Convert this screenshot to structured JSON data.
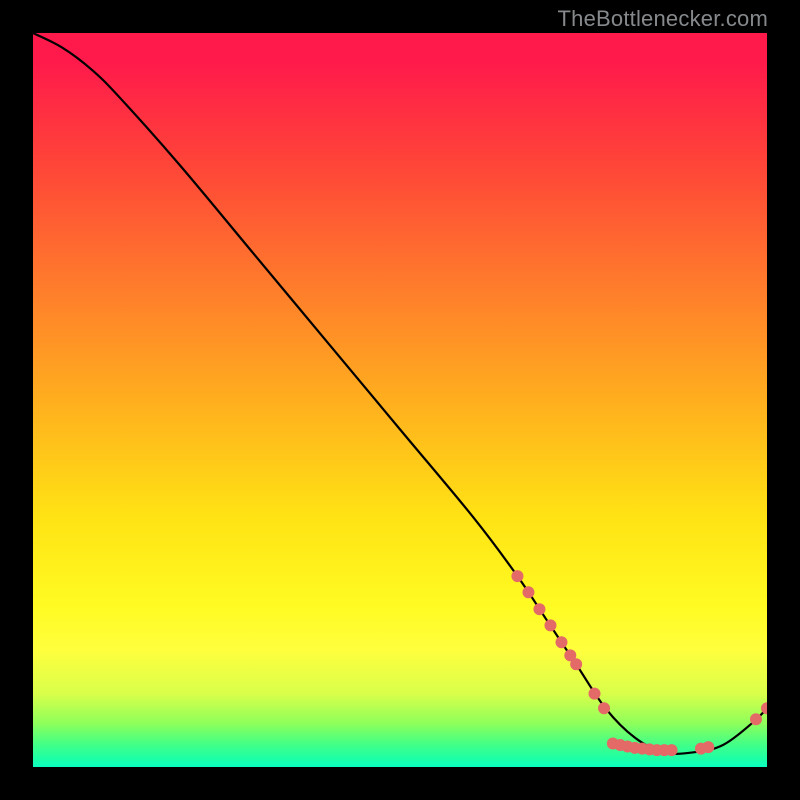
{
  "attribution": "TheBottlenecker.com",
  "chart_data": {
    "type": "line",
    "title": "",
    "xlabel": "",
    "ylabel": "",
    "xlim": [
      0,
      100
    ],
    "ylim": [
      0,
      100
    ],
    "series": [
      {
        "name": "curve",
        "x": [
          0,
          4,
          8,
          12,
          20,
          30,
          40,
          50,
          60,
          66,
          70,
          74,
          78,
          82,
          86,
          90,
          94,
          98,
          100
        ],
        "y": [
          100,
          98,
          95,
          91,
          82,
          70,
          58,
          46,
          34,
          26,
          20,
          14,
          8,
          4,
          2,
          2,
          3,
          6,
          8
        ]
      }
    ],
    "markers": [
      {
        "x": 66.0,
        "y": 26.0
      },
      {
        "x": 67.5,
        "y": 23.8
      },
      {
        "x": 69.0,
        "y": 21.5
      },
      {
        "x": 70.5,
        "y": 19.3
      },
      {
        "x": 72.0,
        "y": 17.0
      },
      {
        "x": 73.2,
        "y": 15.2
      },
      {
        "x": 74.0,
        "y": 14.0
      },
      {
        "x": 76.5,
        "y": 10.0
      },
      {
        "x": 77.8,
        "y": 8.0
      },
      {
        "x": 79.0,
        "y": 3.2
      },
      {
        "x": 80.0,
        "y": 3.0
      },
      {
        "x": 81.0,
        "y": 2.8
      },
      {
        "x": 82.0,
        "y": 2.6
      },
      {
        "x": 83.0,
        "y": 2.5
      },
      {
        "x": 84.0,
        "y": 2.4
      },
      {
        "x": 85.0,
        "y": 2.3
      },
      {
        "x": 86.0,
        "y": 2.3
      },
      {
        "x": 87.0,
        "y": 2.3
      },
      {
        "x": 91.0,
        "y": 2.5
      },
      {
        "x": 92.0,
        "y": 2.7
      },
      {
        "x": 98.5,
        "y": 6.5
      },
      {
        "x": 100.0,
        "y": 8.0
      }
    ],
    "marker_color": "#e46a67",
    "line_color": "#000000"
  }
}
